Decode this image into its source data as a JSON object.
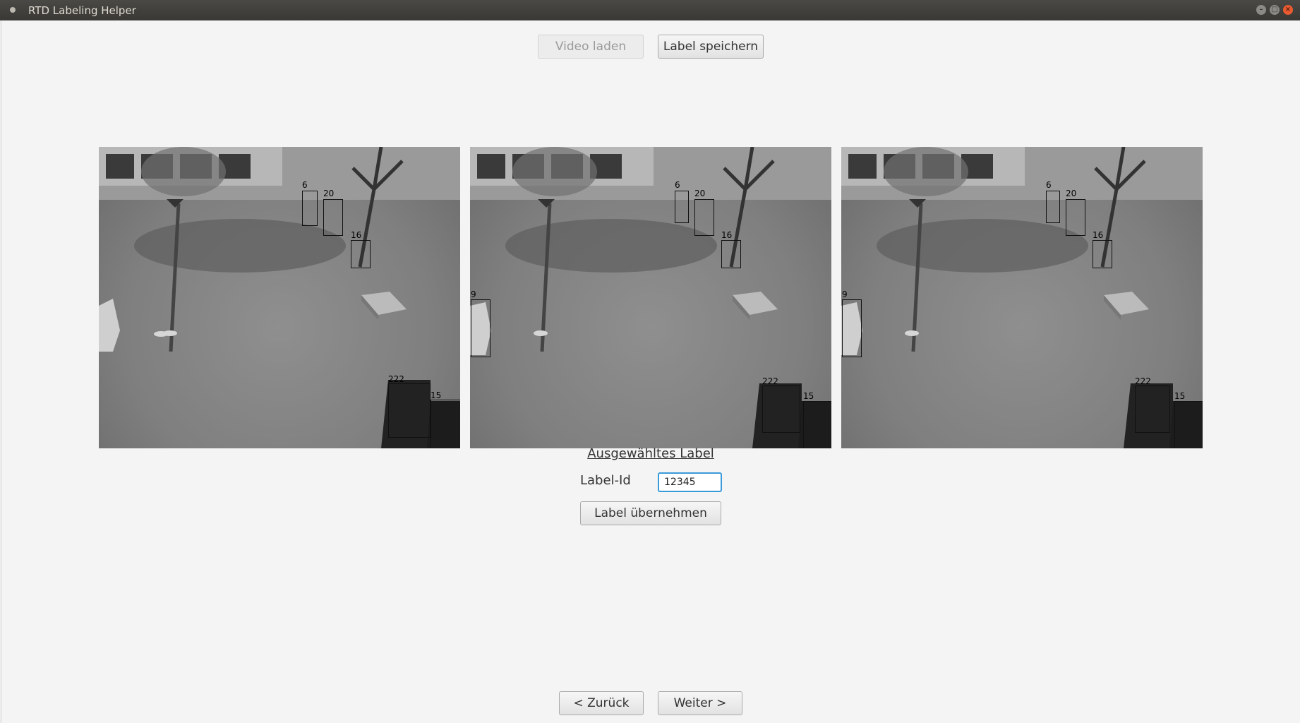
{
  "window": {
    "title": "RTD Labeling Helper",
    "min_glyph": "–",
    "max_glyph": "□",
    "close_glyph": "×"
  },
  "toolbar": {
    "load_video_label": "Video laden",
    "save_label_label": "Label speichern"
  },
  "frames": [
    {
      "boxes": [
        {
          "label": "6"
        },
        {
          "label": "20"
        },
        {
          "label": "16"
        },
        {
          "label": "222"
        },
        {
          "label": "15"
        }
      ]
    },
    {
      "boxes": [
        {
          "label": "6"
        },
        {
          "label": "20"
        },
        {
          "label": "16"
        },
        {
          "label": "9"
        },
        {
          "label": "222"
        },
        {
          "label": "15"
        }
      ]
    },
    {
      "boxes": [
        {
          "label": "6"
        },
        {
          "label": "20"
        },
        {
          "label": "16"
        },
        {
          "label": "9"
        },
        {
          "label": "222"
        },
        {
          "label": "15"
        }
      ]
    }
  ],
  "selected_label": {
    "heading": "Ausgewähltes Label",
    "id_label": "Label-Id",
    "id_value": "12345",
    "apply_button": "Label übernehmen"
  },
  "navigation": {
    "back_label": "< Zurück",
    "next_label": "Weiter >"
  }
}
